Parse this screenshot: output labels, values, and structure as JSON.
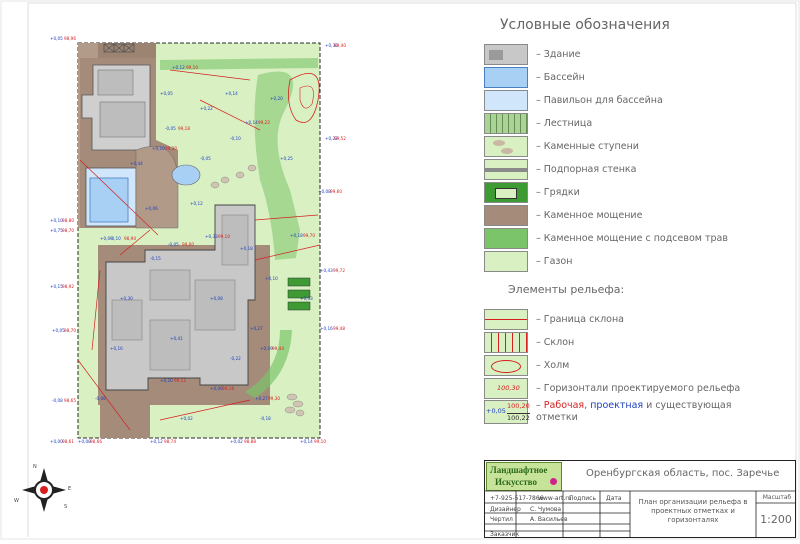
{
  "legend": {
    "title": "Условные обозначения",
    "items": [
      {
        "label": "– Здание"
      },
      {
        "label": "– Бассейн"
      },
      {
        "label": "– Павильон для бассейна"
      },
      {
        "label": "– Лестница"
      },
      {
        "label": "– Каменные ступени"
      },
      {
        "label": "– Подпорная стенка"
      },
      {
        "label": "– Грядки"
      },
      {
        "label": "– Каменное мощение"
      },
      {
        "label": "– Каменное мощение с подсевом трав"
      },
      {
        "label": "– Газон"
      }
    ],
    "relief_title": "Элементы рельефа:",
    "relief_items": [
      {
        "label": "– Граница склона"
      },
      {
        "label": "– Склон"
      },
      {
        "label": "– Холм"
      },
      {
        "label": "– Горизонтали проектируемого рельефа"
      }
    ],
    "marks_label_prefix": "–",
    "marks_label_red": "Рабочая",
    "marks_label_mid": ", ",
    "marks_label_blue": "проектная",
    "marks_label_tail": " и существующая",
    "marks_label_line2": "отметки",
    "contour_value": "100,30",
    "marks_sample": {
      "work": "+0,05",
      "project": "100,20",
      "existing": "100,22"
    }
  },
  "colors": {
    "lawn": "#d9f0c2",
    "paving": "#a48b7a",
    "building": "#c8c8c8",
    "pool": "#a8d0f5",
    "grass_paving": "#7cc46a",
    "garden_bed": "#3e9a32",
    "red_marks": "#d62020",
    "blue_marks": "#2040c0"
  },
  "title_block": {
    "logo_line1": "Ландшафтное",
    "logo_line2": "Искусство",
    "location": "Оренбургская область, пос. Заречье",
    "phone": "+7-925-517-7866",
    "site": "www-art.ru",
    "col_sign": "Подпись",
    "col_date": "Дата",
    "rows": [
      {
        "role": "Дизайнер",
        "name": "С. Чумова"
      },
      {
        "role": "Чертил",
        "name": "А. Васильев"
      },
      {
        "role": "Заказчик",
        "name": ""
      }
    ],
    "sheet_title": "План организации рельефа в проектных отметках и горизонталях",
    "scale_label": "Масштаб",
    "scale_value": "1:200"
  },
  "compass": {
    "north": "N",
    "south": "S",
    "east": "E",
    "west": "W"
  },
  "plan_marks": [
    {
      "t": "+0,05"
    },
    {
      "t": "+0,22"
    },
    {
      "t": "-0,10"
    },
    {
      "t": "+0,12"
    },
    {
      "t": "+0,18"
    },
    {
      "t": "-0,15"
    },
    {
      "t": "+0,30"
    },
    {
      "t": "+0,08"
    },
    {
      "t": "+0,41"
    },
    {
      "t": "-0,22"
    },
    {
      "t": "+0,16"
    },
    {
      "t": "+0,10"
    },
    {
      "t": "+0,25"
    },
    {
      "t": "-0,05"
    },
    {
      "t": "+0,44"
    },
    {
      "t": "+0,09"
    },
    {
      "t": "+0,02"
    },
    {
      "t": "-0,18"
    },
    {
      "t": "+0,33"
    },
    {
      "t": "+0,14"
    },
    {
      "t": "+0,20"
    },
    {
      "t": "+0,06"
    },
    {
      "t": "+0,27"
    },
    {
      "t": "-0,08"
    }
  ]
}
